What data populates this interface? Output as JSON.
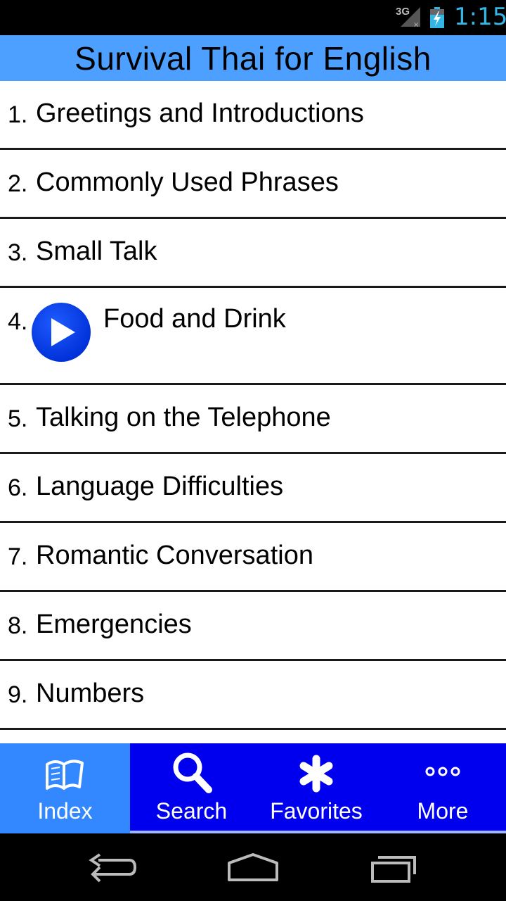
{
  "status_bar": {
    "network": "3G",
    "time": "1:15",
    "time_color": "#33b5e5"
  },
  "header": {
    "title": "Survival Thai for English",
    "background": "#4da0ff"
  },
  "list": {
    "items": [
      {
        "number": "1.",
        "label": "Greetings and Introductions"
      },
      {
        "number": "2.",
        "label": "Commonly Used Phrases"
      },
      {
        "number": "3.",
        "label": "Small Talk"
      },
      {
        "number": "4.",
        "label": "Food and Drink",
        "icon": "play-icon"
      },
      {
        "number": "5.",
        "label": "Talking on the Telephone"
      },
      {
        "number": "6.",
        "label": "Language Difficulties"
      },
      {
        "number": "7.",
        "label": "Romantic Conversation"
      },
      {
        "number": "8.",
        "label": "Emergencies"
      },
      {
        "number": "9.",
        "label": "Numbers"
      }
    ]
  },
  "tabs": [
    {
      "label": "Index",
      "icon": "book-icon",
      "active": true
    },
    {
      "label": "Search",
      "icon": "search-icon",
      "active": false
    },
    {
      "label": "Favorites",
      "icon": "asterisk-icon",
      "active": false
    },
    {
      "label": "More",
      "icon": "more-icon",
      "active": false
    }
  ],
  "colors": {
    "tab_bar": "#0000ee",
    "tab_active": "#3388ff",
    "play_button": "#0a3ef0"
  },
  "nav_bar": {
    "buttons": [
      "back-icon",
      "home-icon",
      "recent-apps-icon"
    ]
  }
}
